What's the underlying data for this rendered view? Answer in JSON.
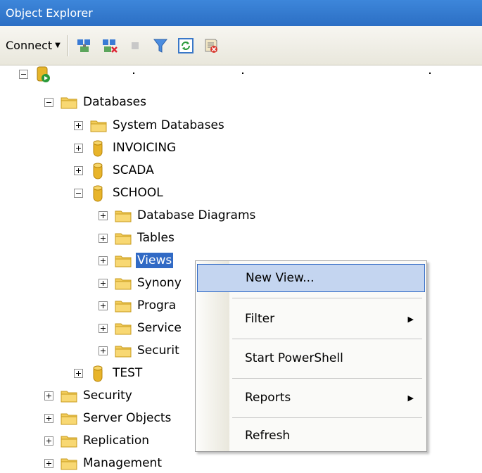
{
  "window": {
    "title": "Object Explorer"
  },
  "toolbar": {
    "connect_label": "Connect",
    "buttons": [
      "connect-object-explorer-icon",
      "disconnect-icon",
      "stop-icon",
      "filter-icon",
      "refresh-icon",
      "summary-icon"
    ]
  },
  "tree": {
    "server": "",
    "databases": "Databases",
    "system_databases": "System Databases",
    "invoicing": "INVOICING",
    "scada": "SCADA",
    "school": "SCHOOL",
    "database_diagrams": "Database Diagrams",
    "tables": "Tables",
    "views": "Views",
    "synonyms": "Synony",
    "programmability": "Progra",
    "service_broker": "Service",
    "security_db": "Securit",
    "test": "TEST",
    "security": "Security",
    "server_objects": "Server Objects",
    "replication": "Replication",
    "management": "Management"
  },
  "context_menu": {
    "new_view": "New View...",
    "filter": "Filter",
    "start_powershell": "Start PowerShell",
    "reports": "Reports",
    "refresh": "Refresh"
  }
}
